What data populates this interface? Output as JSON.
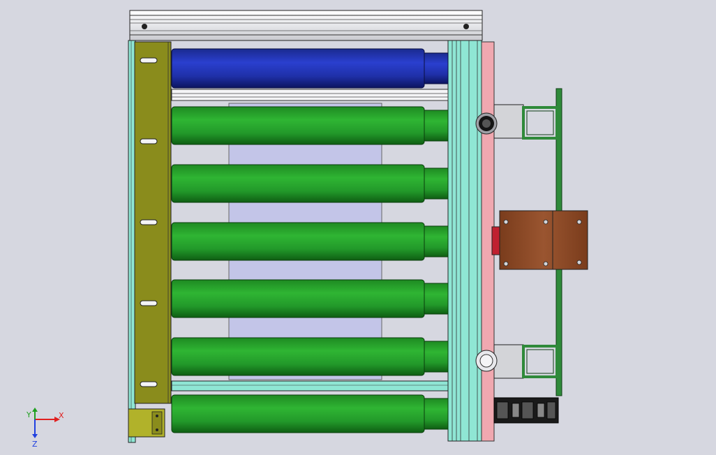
{
  "colors": {
    "background": "#d6d7e0",
    "frame_rail": "#f2f3f5",
    "aluminium_profile": "#8fe6d4",
    "drive_roller": "#1c2ea8",
    "conveyor_roller": "#27a52c",
    "side_plate": "#8a8c1c",
    "belt_panel": "#c3c5e8",
    "pink_strip": "#f0a8b0",
    "motor_block": "#8b4a26",
    "bracket_green": "#2f8a3a",
    "bracket_grey": "#d3d4d8"
  },
  "roller_count": 7,
  "triad": {
    "x_label": "X",
    "y_label": "Y",
    "z_label": "Z",
    "x_color": "#e02020",
    "y_color": "#20a020",
    "z_color": "#2040e0"
  }
}
